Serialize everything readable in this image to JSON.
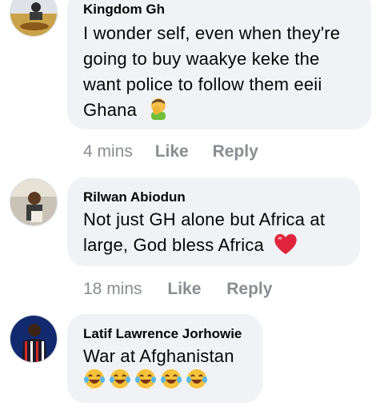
{
  "comments": [
    {
      "author": "Kingdom Gh",
      "lines": [
        "I wonder self, even when they're",
        "going to buy waakye keke the",
        "want police to follow them eeii",
        "Ghana"
      ],
      "emoji_name": "man-facepalming-icon",
      "time": "4 mins",
      "like": "Like",
      "reply": "Reply"
    },
    {
      "author": "Rilwan Abiodun",
      "lines": [
        "Not just GH alone but Africa at",
        "large, God bless Africa"
      ],
      "emoji_name": "red-heart-icon",
      "time": "18 mins",
      "like": "Like",
      "reply": "Reply"
    },
    {
      "author": "Latif Lawrence Jorhowie",
      "lines": [
        "War at Afghanistan"
      ],
      "emoji_name": "tears-of-joy-icon",
      "emoji_count": 5
    }
  ],
  "colors": {
    "bubble": "#f0f2f5",
    "text": "#050505",
    "meta": "#8a8d91",
    "heart": "#e0243b"
  }
}
